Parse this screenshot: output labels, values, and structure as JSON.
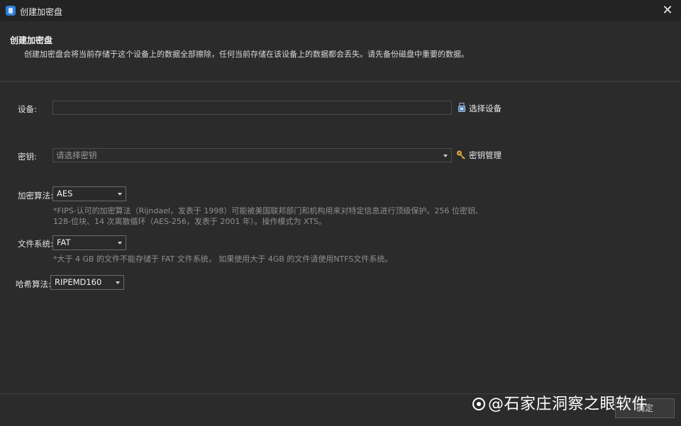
{
  "window": {
    "title": "创建加密盘",
    "close_icon": "close-icon"
  },
  "header": {
    "title": "创建加密盘",
    "description": "创建加密盘会将当前存储于这个设备上的数据全部擦除，任何当前存储在该设备上的数据都会丢失。请先备份磁盘中重要的数据。"
  },
  "device": {
    "label": "设备:",
    "value": "",
    "select_label": "选择设备",
    "icon": "usb-drive-icon"
  },
  "key": {
    "label": "密钥:",
    "placeholder": "请选择密钥",
    "manage_label": "密钥管理",
    "icon": "key-icon"
  },
  "algorithm": {
    "label": "加密算法:",
    "selected": "AES",
    "note_line1": "*FIPS-认可的加密算法（Rijndael，发表于 1998）可能被美国联邦部门和机构用来对特定信息进行顶级保护。256 位密钥、",
    "note_line2": "128-位块、14 次离散循环（AES-256，发表于 2001 年）。操作模式为 XTS。"
  },
  "filesystem": {
    "label": "文件系统:",
    "selected": "FAT",
    "note": "*大于 4 GB 的文件不能存储于 FAT 文件系统， 如果使用大于 4GB 的文件请使用NTFS文件系统。"
  },
  "hash": {
    "label": "哈希算法:",
    "selected": "RIPEMD160"
  },
  "footer": {
    "ok_label": "确定"
  },
  "watermark": {
    "text": "@石家庄洞察之眼软件"
  },
  "colors": {
    "background": "#2b2b2b",
    "titlebar": "#232323",
    "accent_key": "#e2a83a"
  }
}
